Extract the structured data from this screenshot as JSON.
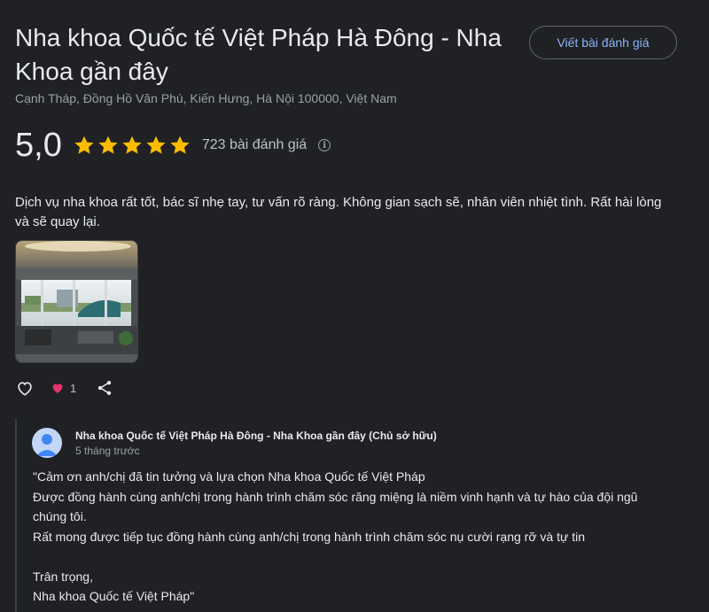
{
  "business": {
    "name": "Nha khoa Quốc tế Việt Pháp Hà Đông - Nha Khoa gần đây",
    "address": "Cạnh Tháp, Đồng Hồ Văn Phú, Kiến Hưng, Hà Nội 100000, Việt Nam",
    "rating": "5,0",
    "stars": 5,
    "review_count": "723 bài đánh giá"
  },
  "write_review_button": "Viết bài đánh giá",
  "review": {
    "text": "Dịch vụ nha khoa rất tốt, bác sĩ nhẹ tay, tư vấn rõ ràng. Không gian sạch sẽ, nhân viên nhiệt tình. Rất hài lòng và sẽ quay lại.",
    "reaction_count": "1"
  },
  "owner_response": {
    "name": "Nha khoa Quốc tế Việt Pháp Hà Đông - Nha Khoa gần đây (Chủ sở hữu)",
    "date": "5 tháng trước",
    "lines": [
      "\"Cảm ơn anh/chị đã tin tưởng và lựa chọn Nha khoa Quốc tế Việt Pháp",
      "Được đồng hành cùng anh/chị trong hành trình chăm sóc răng miệng là niềm vinh hạnh và tự hào của đội ngũ chúng tôi.",
      "Rất mong được tiếp tục đồng hành cùng anh/chị trong hành trình chăm sóc nụ cười rạng rỡ và tự tin",
      "",
      "Trân trọng,",
      "Nha khoa Quốc tế Việt Pháp\""
    ]
  },
  "colors": {
    "background": "#202124",
    "star": "#fbbc04",
    "link": "#8ab4f8",
    "heart": "#e8336d"
  },
  "icons": [
    "star-icon",
    "info-icon",
    "heart-outline-icon",
    "heart-filled-icon",
    "share-icon",
    "avatar-icon"
  ]
}
